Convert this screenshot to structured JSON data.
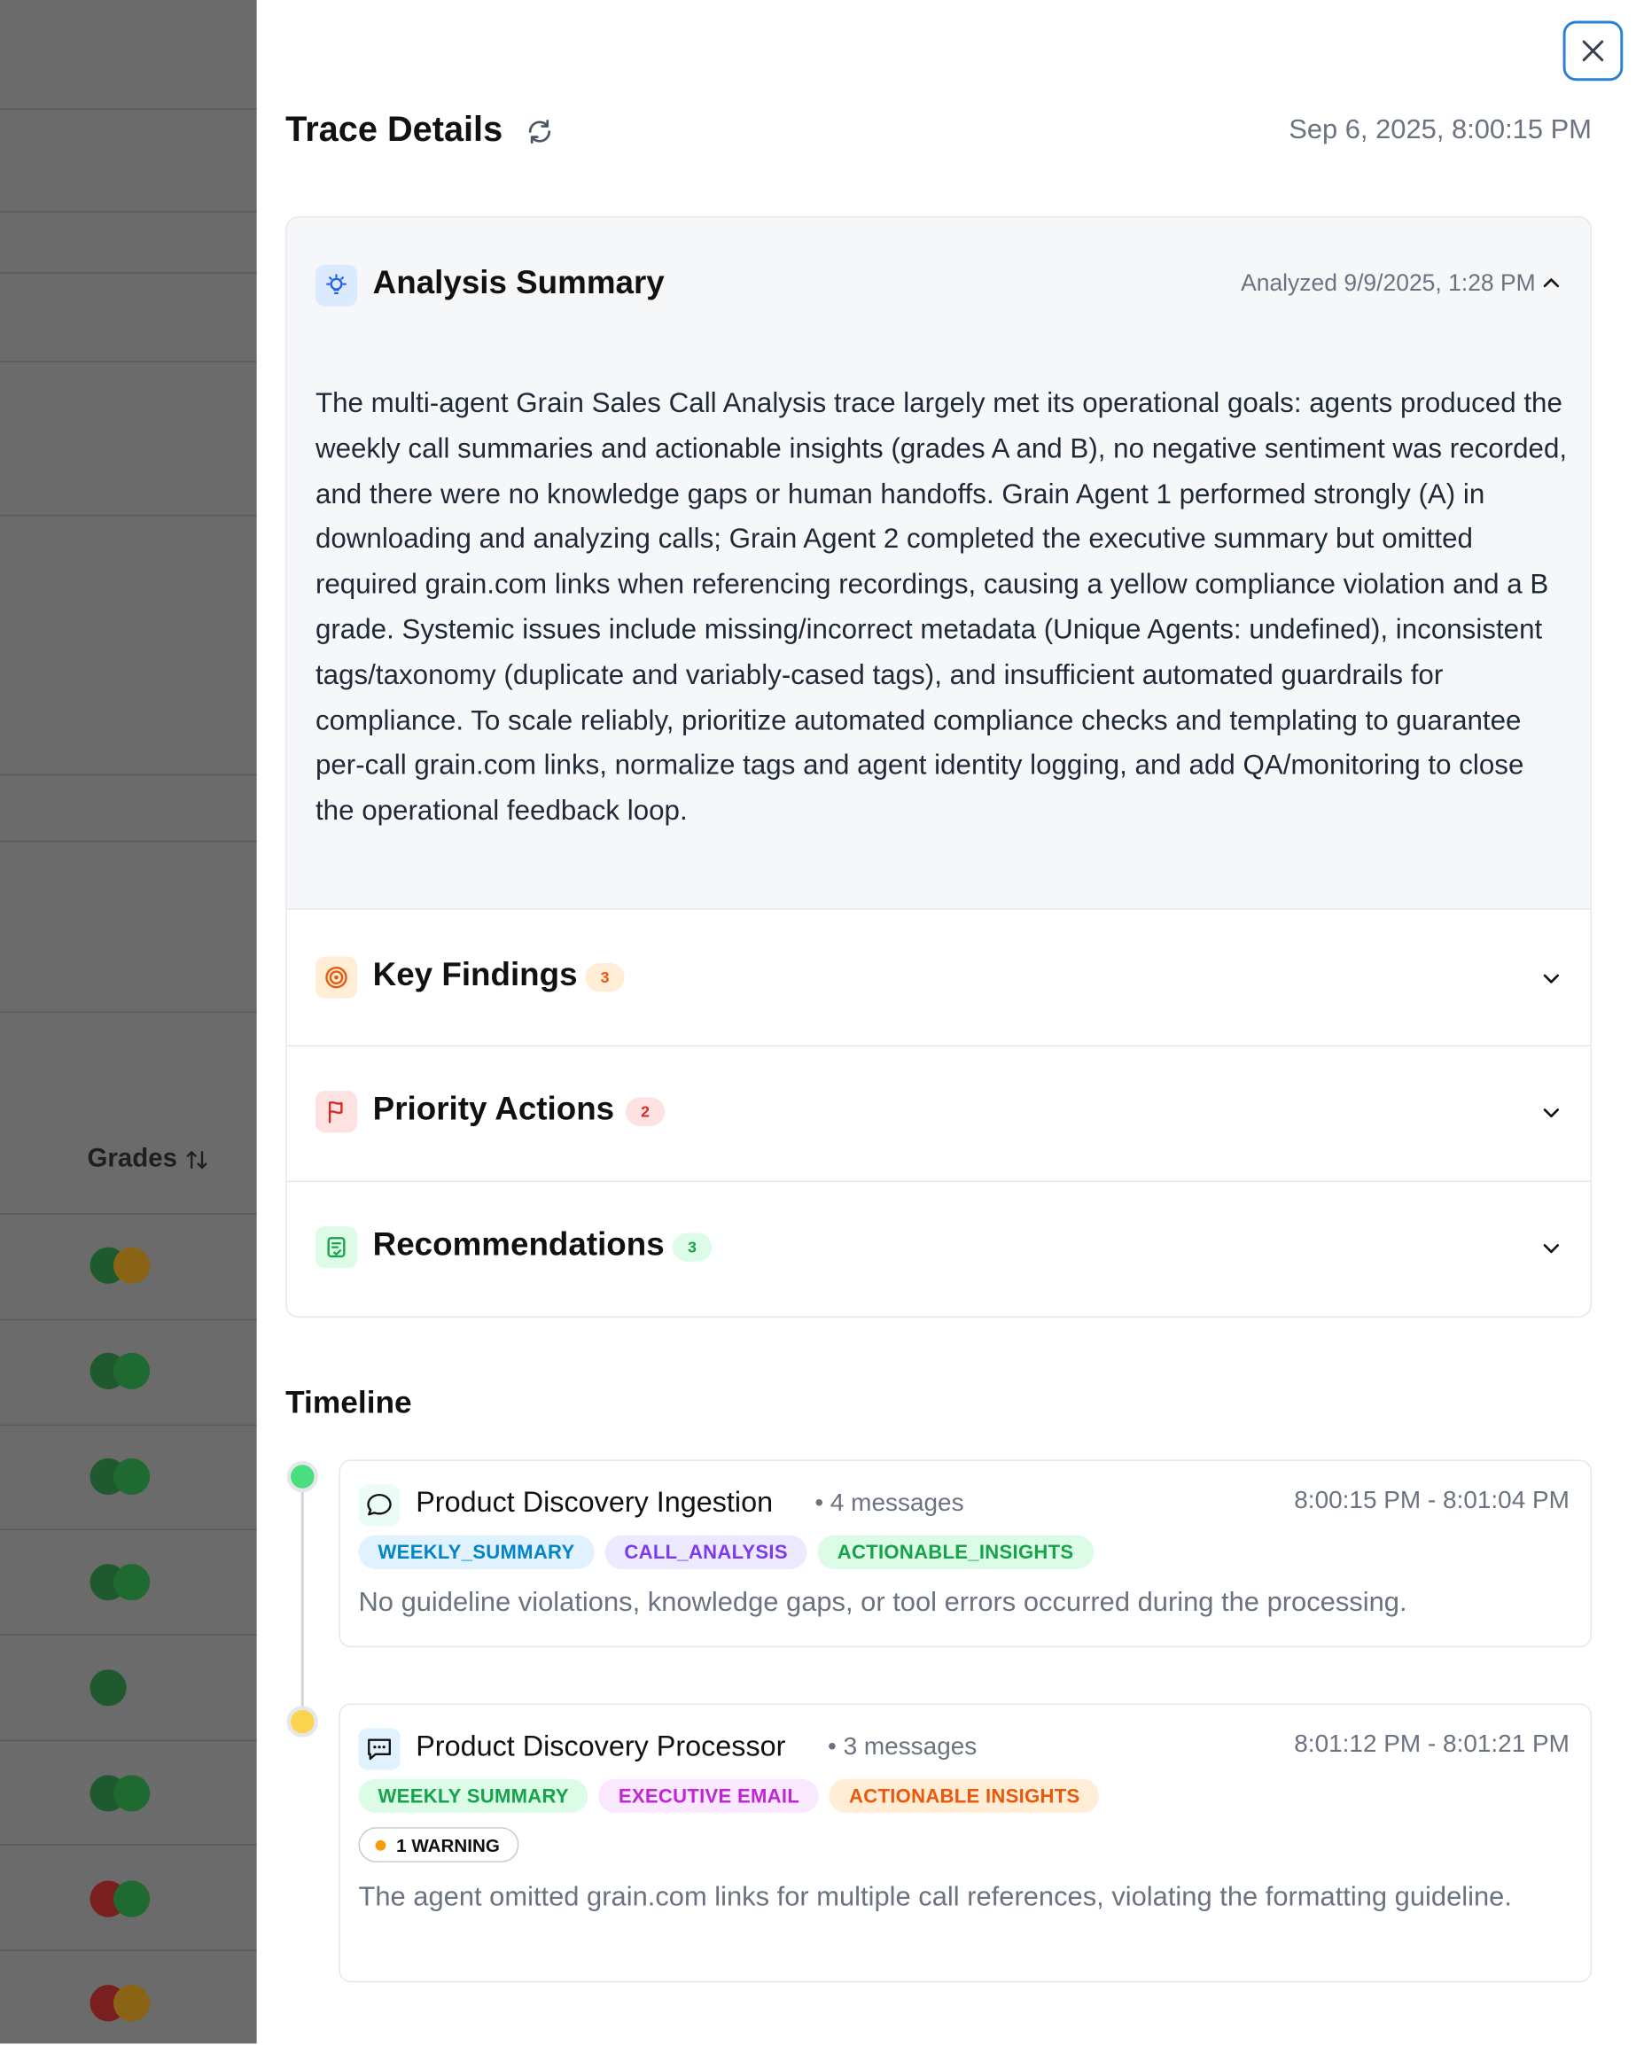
{
  "background": {
    "grades_header": "Grades",
    "grade_rows": [
      [
        "#1f5a2e",
        "#8a6414"
      ],
      [
        "#1f5a2e",
        "#1f6a30"
      ],
      [
        "#1f5a2e",
        "#1f6a30"
      ],
      [
        "#1f5a2e",
        "#1f6a30"
      ],
      [
        "#1f5a2e"
      ],
      [
        "#1f5a2e",
        "#1f6a30"
      ],
      [
        "#7a1f1f",
        "#1f6a30"
      ],
      [
        "#7a1f1f",
        "#8a6414"
      ]
    ]
  },
  "panel": {
    "title": "Trace Details",
    "date": "Sep 6, 2025, 8:00:15 PM",
    "analysis": {
      "title": "Analysis Summary",
      "analyzed": "Analyzed 9/9/2025, 1:28 PM",
      "summary": "The multi-agent Grain Sales Call Analysis trace largely met its operational goals: agents produced the weekly call summaries and actionable insights (grades A and B), no negative sentiment was recorded, and there were no knowledge gaps or human handoffs. Grain Agent 1 performed strongly (A) in downloading and analyzing calls; Grain Agent 2 completed the executive summary but omitted required grain.com links when referencing recordings, causing a yellow compliance violation and a B grade. Systemic issues include missing/incorrect metadata (Unique Agents: undefined), inconsistent tags/taxonomy (duplicate and variably-cased tags), and insufficient automated guardrails for compliance. To scale reliably, prioritize automated compliance checks and templating to guarantee per-call grain.com links, normalize tags and agent identity logging, and add QA/monitoring to close the operational feedback loop."
    },
    "sections": [
      {
        "title": "Key Findings",
        "count": "3"
      },
      {
        "title": "Priority Actions",
        "count": "2"
      },
      {
        "title": "Recommendations",
        "count": "3"
      }
    ],
    "timeline": {
      "title": "Timeline",
      "events": [
        {
          "title": "Product Discovery Ingestion",
          "meta": "• 4 messages",
          "time": "8:00:15 PM - 8:01:04 PM",
          "tags": [
            "WEEKLY_SUMMARY",
            "CALL_ANALYSIS",
            "ACTIONABLE_INSIGHTS"
          ],
          "description": "No guideline violations, knowledge gaps, or tool errors occurred during the processing."
        },
        {
          "title": "Product Discovery Processor",
          "meta": "• 3 messages",
          "time": "8:01:12 PM - 8:01:21 PM",
          "tags": [
            "WEEKLY SUMMARY",
            "EXECUTIVE EMAIL",
            "ACTIONABLE INSIGHTS"
          ],
          "warning": "1 WARNING",
          "description": "The agent omitted grain.com links for multiple call references, violating the formatting guideline."
        }
      ]
    }
  }
}
